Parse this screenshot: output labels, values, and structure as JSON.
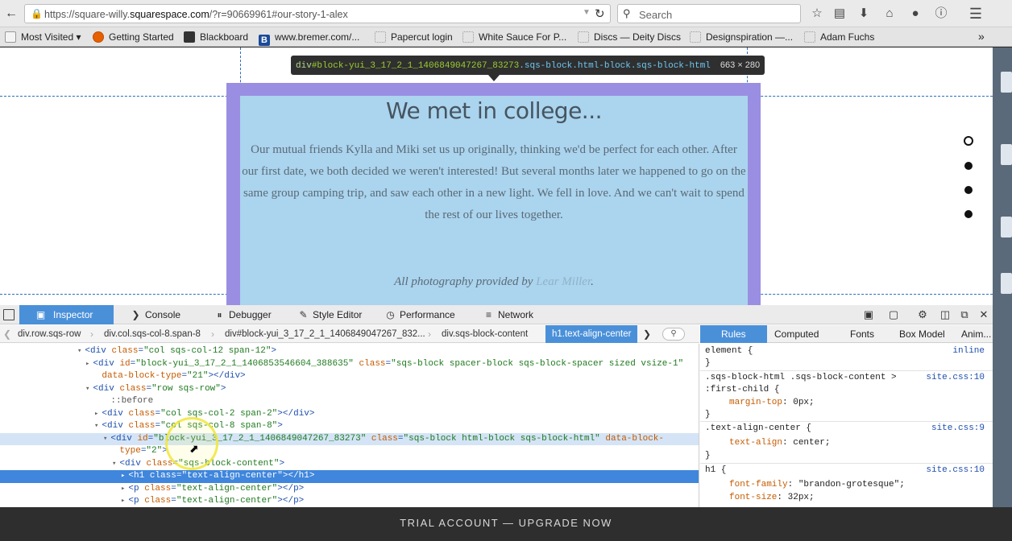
{
  "browser": {
    "url_prefix": "https://square-willy.",
    "url_host": "squarespace.com",
    "url_rest": "/?r=90669961#our-story-1-alex",
    "search_placeholder": "Search"
  },
  "bookmarks": [
    {
      "label": "Most Visited ▾",
      "icon": "star-folder-icon"
    },
    {
      "label": "Getting Started",
      "icon": "firefox-icon"
    },
    {
      "label": "Blackboard",
      "icon": "blackboard-icon"
    },
    {
      "label": "www.bremer.com/...",
      "icon": "b-logo-icon"
    },
    {
      "label": "Papercut login",
      "icon": "page-icon"
    },
    {
      "label": "White Sauce For P...",
      "icon": "page-icon"
    },
    {
      "label": "Discs — Deity Discs",
      "icon": "page-icon"
    },
    {
      "label": "Designspiration —...",
      "icon": "page-icon"
    },
    {
      "label": "Adam Fuchs",
      "icon": "page-icon"
    }
  ],
  "page": {
    "title": "We met in college...",
    "body": "Our mutual friends Kylla and Miki set us up originally, thinking we'd be perfect for each other. After our first date, we both decided we weren't interested! But several months later we happened to go on the same group camping trip, and saw each other in a new light. We fell in love. And we can't wait to spend the rest of our lives together.",
    "credit_text": "All photography provided by ",
    "credit_link": "Lear Miller",
    "credit_end": ".",
    "tooltip": {
      "tag": "div",
      "id": "#block-yui_3_17_2_1_1406849047267_83273",
      "cls": ".sqs-block.html-block.sqs-block-html",
      "dims": "663 × 280"
    }
  },
  "devtools": {
    "tabs": [
      {
        "label": "Inspector",
        "icon": "inspector-icon"
      },
      {
        "label": "Console",
        "icon": "console-icon"
      },
      {
        "label": "Debugger",
        "icon": "debugger-icon"
      },
      {
        "label": "Style Editor",
        "icon": "style-editor-icon"
      },
      {
        "label": "Performance",
        "icon": "performance-icon"
      },
      {
        "label": "Network",
        "icon": "network-icon"
      }
    ],
    "breadcrumbs": [
      "div.row.sqs-row",
      "div.col.sqs-col-8.span-8",
      "div#block-yui_3_17_2_1_1406849047267_832...",
      "div.sqs-block-content",
      "h1.text-align-center"
    ],
    "markup": [
      {
        "tw": "▾",
        "indent": 106,
        "html": "<span class=\"tg\">&lt;div</span> <span class=\"an\">class</span>=<span class=\"av\">\"col sqs-col-12 span-12\"</span>&gt;"
      },
      {
        "tw": "▸",
        "indent": 116,
        "html": "&lt;div <span class=\"an\">id</span>=<span class=\"av\">\"block-yui_3_17_2_1_1406853546604_388635\"</span> <span class=\"an\">class</span>=<span class=\"av\">\"sqs-block spacer-block sqs-block-spacer sized vsize-1\"</span>"
      },
      {
        "tw": "",
        "indent": 127,
        "html": "<span class=\"an\">data-block-type</span>=<span class=\"av\">\"21\"</span>&gt;&lt;/div&gt;"
      },
      {
        "tw": "▾",
        "indent": 116,
        "html": "&lt;div <span class=\"an\">class</span>=<span class=\"av\">\"row sqs-row\"</span>&gt;"
      },
      {
        "tw": "",
        "indent": 138,
        "html": "<span class=\"pseudo\">::before</span>"
      },
      {
        "tw": "▸",
        "indent": 127,
        "html": "&lt;div <span class=\"an\">class</span>=<span class=\"av\">\"col sqs-col-2 span-2\"</span>&gt;&lt;/div&gt;"
      },
      {
        "tw": "▾",
        "indent": 127,
        "html": "&lt;div <span class=\"an\">class</span>=<span class=\"av\">\"col sqs-col-8 span-8\"</span>&gt;"
      },
      {
        "tw": "▾",
        "indent": 138,
        "html": "&lt;div <span class=\"an\">id</span>=<span class=\"av\">\"block-yui_3_17_2_1_1406849047267_83273\"</span> <span class=\"an\">class</span>=<span class=\"av\">\"sqs-block html-block sqs-block-html\"</span> <span class=\"an\">data-block-</span>"
      },
      {
        "tw": "",
        "indent": 149,
        "html": "<span class=\"an\">type</span>=<span class=\"av\">\"2\"</span>&gt;"
      },
      {
        "tw": "▾",
        "indent": 149,
        "html": "&lt;div <span class=\"an\">class</span>=<span class=\"av\">\"sqs-block-content\"</span>&gt;"
      },
      {
        "tw": "▸",
        "indent": 160,
        "html": "&lt;h1 <span class=\"an\">class</span>=<span class=\"av\">\"text-align-center\"</span>&gt;&lt;/h1&gt;"
      },
      {
        "tw": "▸",
        "indent": 160,
        "html": "&lt;p <span class=\"an\">class</span>=<span class=\"av\">\"text-align-center\"</span>&gt;&lt;/p&gt;"
      },
      {
        "tw": "▸",
        "indent": 160,
        "html": "&lt;p <span class=\"an\">class</span>=<span class=\"av\">\"text-align-center\"</span>&gt;&lt;/p&gt;"
      }
    ],
    "side_tabs": [
      "Rules",
      "Computed",
      "Fonts",
      "Box Model",
      "Anim..."
    ],
    "rules": {
      "element_sel": "element {",
      "element_src": "inline",
      "rule1_sel": ".sqs-block-html .sqs-block-content >",
      "rule1_sel2": ":first-child {",
      "rule1_src": "site.css:10",
      "rule1_prop": "margin-top",
      "rule1_val": "0px;",
      "rule2_sel": ".text-align-center {",
      "rule2_src": "site.css:9",
      "rule2_prop": "text-align",
      "rule2_val": "center;",
      "rule3_sel": "h1 {",
      "rule3_src": "site.css:10",
      "rule3_prop1": "font-family",
      "rule3_val1": "\"brandon-grotesque\";",
      "rule3_prop2": "font-size",
      "rule3_val2": "32px;",
      "close": "}"
    }
  },
  "footer": "TRIAL ACCOUNT — UPGRADE NOW"
}
